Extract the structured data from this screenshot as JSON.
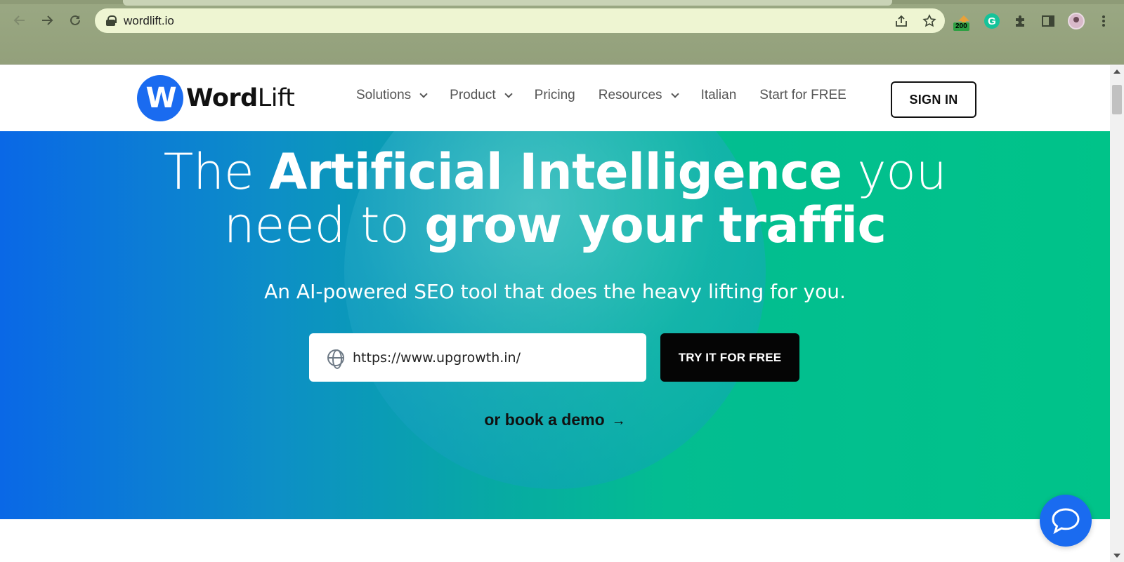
{
  "browser": {
    "url": "wordlift.io",
    "extension_badge": "200",
    "grammarly_letter": "G"
  },
  "header": {
    "logo": {
      "mark": "W",
      "word_bold": "Word",
      "word_light": "Lift"
    },
    "nav": [
      {
        "label": "Solutions",
        "has_dropdown": true
      },
      {
        "label": "Product",
        "has_dropdown": true
      },
      {
        "label": "Pricing",
        "has_dropdown": false
      },
      {
        "label": "Resources",
        "has_dropdown": true
      },
      {
        "label": "Italian",
        "has_dropdown": false
      },
      {
        "label": "Start for FREE",
        "has_dropdown": false
      }
    ],
    "signin_label": "SIGN IN"
  },
  "hero": {
    "title_1": "The ",
    "title_2": "Artificial Intelligence",
    "title_3": " you",
    "title_4": "need to ",
    "title_5": "grow your traffic",
    "subtitle": "An AI-powered SEO tool that does the heavy lifting for you.",
    "url_value": "https://www.upgrowth.in/",
    "cta_label": "TRY IT FOR FREE",
    "demo_label": "or book a demo",
    "demo_arrow": "→"
  },
  "colors": {
    "brand_blue": "#1a6bf0",
    "gradient_start": "#0a68e6",
    "gradient_end": "#00c389",
    "cta_bg": "#050505"
  },
  "icons": [
    "back-arrow-icon",
    "forward-arrow-icon",
    "reload-icon",
    "lock-icon",
    "share-icon",
    "star-icon",
    "puzzle-icon",
    "sidepanel-icon",
    "kebab-menu-icon",
    "globe-icon",
    "chat-icon"
  ]
}
